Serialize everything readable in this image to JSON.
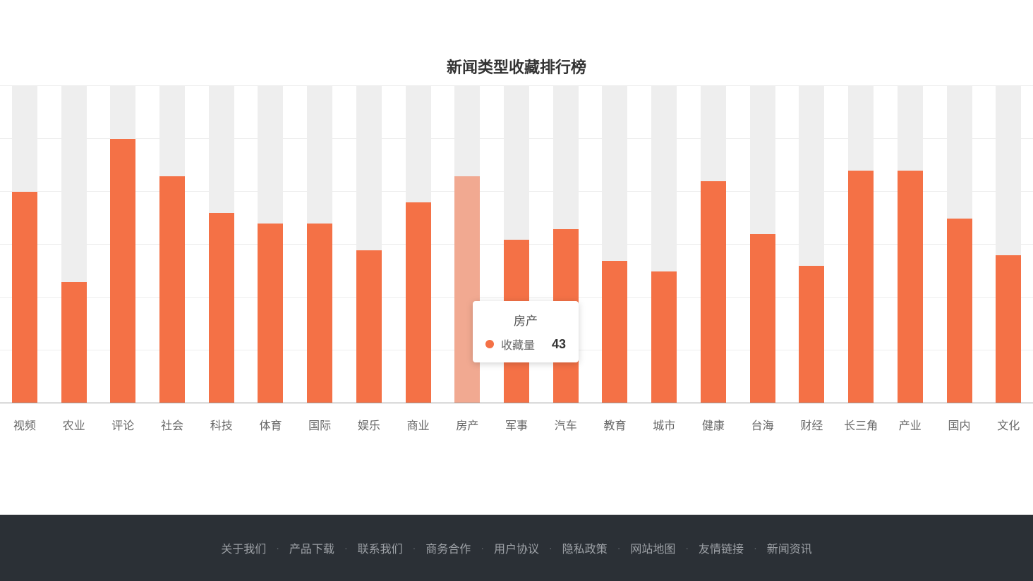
{
  "chart_data": {
    "type": "bar",
    "title": "新闻类型收藏排行榜",
    "series_name": "收藏量",
    "categories": [
      "视频",
      "农业",
      "评论",
      "社会",
      "科技",
      "体育",
      "国际",
      "娱乐",
      "商业",
      "房产",
      "军事",
      "汽车",
      "教育",
      "城市",
      "健康",
      "台海",
      "财经",
      "长三角",
      "产业",
      "国内",
      "文化"
    ],
    "values": [
      40,
      23,
      50,
      43,
      36,
      34,
      34,
      29,
      38,
      43,
      31,
      33,
      27,
      25,
      42,
      32,
      26,
      44,
      44,
      35,
      28
    ],
    "ylim": [
      0,
      60
    ],
    "gridlines": [
      0,
      10,
      20,
      30,
      40,
      50,
      60
    ],
    "bar_color": "#f47146",
    "hover_index": 9
  },
  "tooltip": {
    "category": "房产",
    "series": "收藏量",
    "value": "43"
  },
  "footer": {
    "links": [
      "关于我们",
      "产品下载",
      "联系我们",
      "商务合作",
      "用户协议",
      "隐私政策",
      "网站地图",
      "友情链接",
      "新闻资讯"
    ]
  }
}
